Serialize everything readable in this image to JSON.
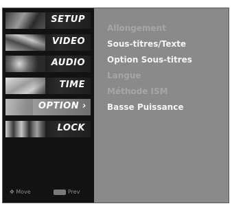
{
  "sidebar": {
    "items": [
      {
        "label": "SETUP",
        "active": false
      },
      {
        "label": "VIDEO",
        "active": false
      },
      {
        "label": "AUDIO",
        "active": false
      },
      {
        "label": "TIME",
        "active": false
      },
      {
        "label": "OPTION",
        "active": true,
        "arrow": "›"
      },
      {
        "label": "LOCK",
        "active": false
      }
    ],
    "hints": {
      "move_icon": "move-arrows-icon",
      "move_label": "Move",
      "prev_key": "MENU",
      "prev_label": "Prev"
    }
  },
  "options": [
    {
      "label": "Allongement",
      "enabled": false
    },
    {
      "label": "Sous-titres/Texte",
      "enabled": true
    },
    {
      "label": "Option Sous-titres",
      "enabled": true
    },
    {
      "label": "Langue",
      "enabled": false
    },
    {
      "label": "Méthode ISM",
      "enabled": false
    },
    {
      "label": "Basse Puissance",
      "enabled": true
    }
  ],
  "colors": {
    "panel": "#8a8a8a",
    "sidebar": "#121212",
    "text_enabled": "#f4f4f4",
    "text_disabled": "#a6a6a6"
  }
}
